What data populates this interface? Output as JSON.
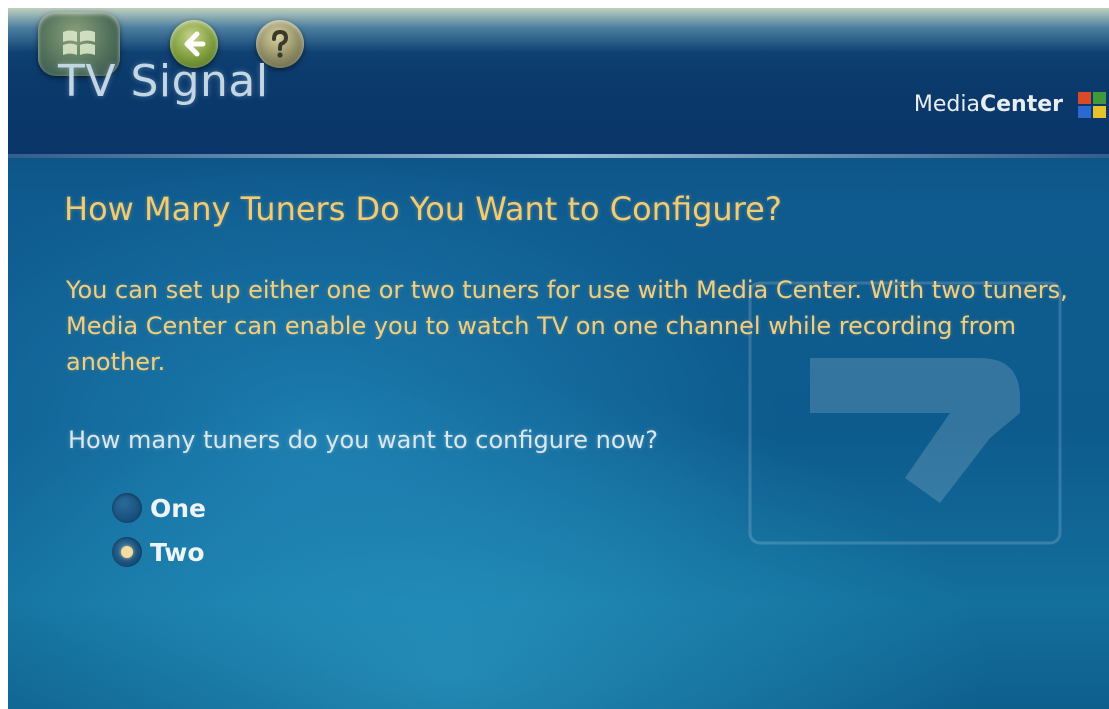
{
  "header": {
    "title": "TV Signal",
    "brand_prefix": "Media",
    "brand_suffix": "Center"
  },
  "nav": {
    "start_icon": "windows-flag-icon",
    "back_icon": "back-arrow-icon",
    "help_icon": "help-question-icon"
  },
  "content": {
    "heading": "How Many Tuners Do You Want to Configure?",
    "description": "You can set up either one or two tuners for use with Media Center. With two tuners, Media Center can enable you to watch TV on one channel while recording from another.",
    "question": "How many tuners do you want to configure now?",
    "options": [
      {
        "label": "One",
        "selected": false
      },
      {
        "label": "Two",
        "selected": true
      }
    ]
  },
  "colors": {
    "heading": "#f2cb72",
    "background": "#0f5b8f",
    "selected_dot": "#f5dca0"
  }
}
